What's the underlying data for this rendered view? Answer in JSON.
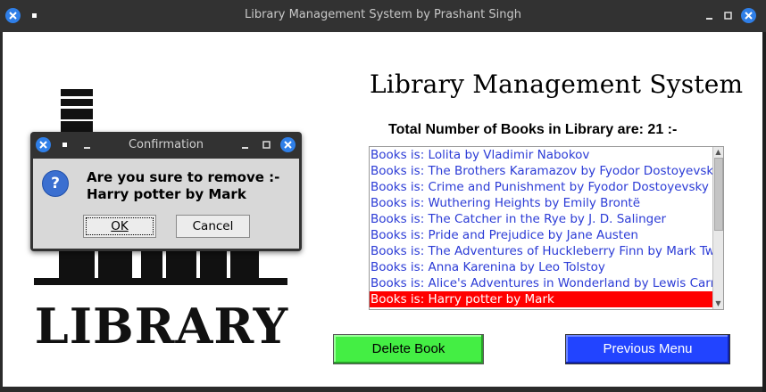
{
  "window": {
    "title": "Library Management System by Prashant Singh"
  },
  "main": {
    "heading": "Library Management System",
    "total_label": "Total Number of Books in Library are: 21 :-",
    "books": [
      "Books is: Lolita by Vladimir Nabokov",
      "Books is: The Brothers Karamazov by Fyodor Dostoyevsky",
      "Books is: Crime and Punishment by Fyodor Dostoyevsky",
      "Books is: Wuthering Heights by Emily Brontë",
      "Books is: The Catcher in the Rye by J. D. Salinger",
      "Books is: Pride and Prejudice by Jane Austen",
      "Books is: The Adventures of Huckleberry Finn by Mark Twain",
      "Books is: Anna Karenina by Leo Tolstoy",
      "Books is: Alice's Adventures in Wonderland by Lewis Carroll",
      "Books is: Harry potter by Mark"
    ],
    "selected_book": "Books is: Harry potter by Mark",
    "delete_button": "Delete Book",
    "previous_button": "Previous Menu",
    "logo_text": "LIBRARY"
  },
  "dialog": {
    "title": "Confirmation",
    "message_line1": "Are you sure to remove :-",
    "message_line2": "Harry potter by Mark",
    "ok_label": "OK",
    "cancel_label": "Cancel",
    "icon": "question-icon"
  },
  "colors": {
    "list_text": "#2b3bd6",
    "selection": "#ff0000",
    "delete_button": "#44ee44",
    "previous_button": "#2244ff",
    "titlebar_close": "#2f7fe8"
  }
}
